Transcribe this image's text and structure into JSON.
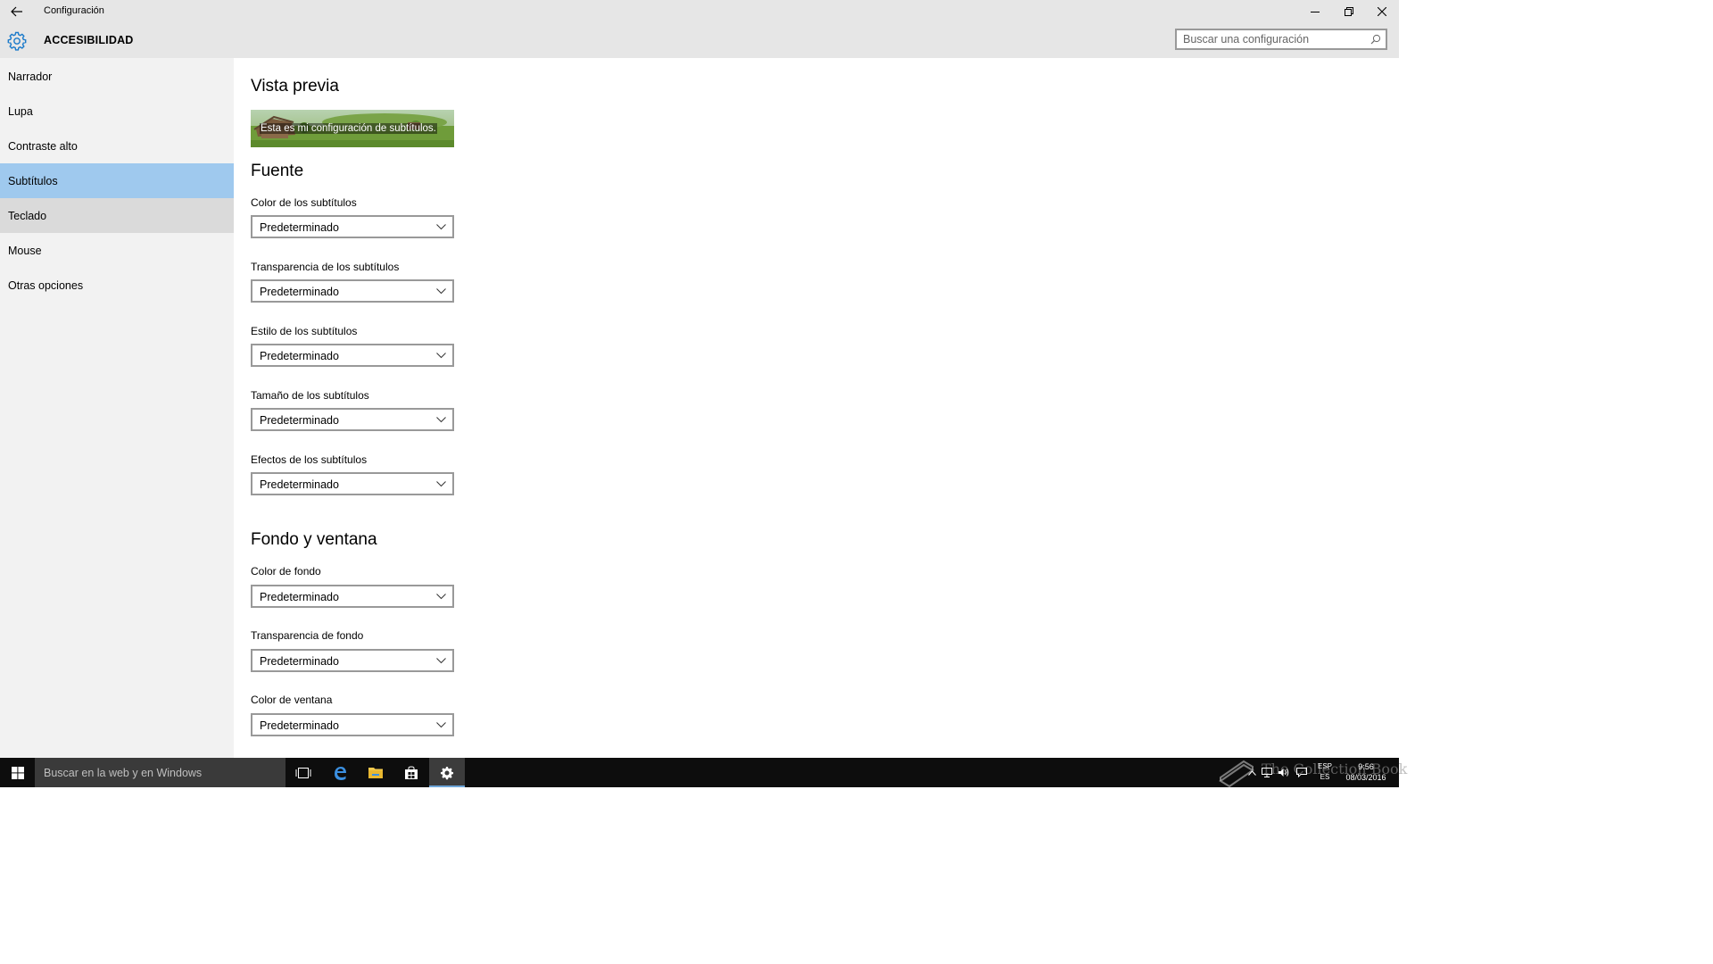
{
  "window": {
    "title": "Configuración"
  },
  "header": {
    "section_title": "ACCESIBILIDAD",
    "search_placeholder": "Buscar una configuración"
  },
  "sidebar": {
    "items": [
      {
        "label": "Narrador"
      },
      {
        "label": "Lupa"
      },
      {
        "label": "Contraste alto"
      },
      {
        "label": "Subtítulos",
        "selected": true
      },
      {
        "label": "Teclado"
      },
      {
        "label": "Mouse"
      },
      {
        "label": "Otras opciones"
      }
    ]
  },
  "main": {
    "preview_heading": "Vista previa",
    "preview_text": "Esta es mi configuración de subtítulos.",
    "font_heading": "Fuente",
    "font_settings": [
      {
        "label": "Color de los subtítulos",
        "value": "Predeterminado"
      },
      {
        "label": "Transparencia de los subtítulos",
        "value": "Predeterminado"
      },
      {
        "label": "Estilo de los subtítulos",
        "value": "Predeterminado"
      },
      {
        "label": "Tamaño de los subtítulos",
        "value": "Predeterminado"
      },
      {
        "label": "Efectos de los subtítulos",
        "value": "Predeterminado"
      }
    ],
    "background_heading": "Fondo y ventana",
    "background_settings": [
      {
        "label": "Color de fondo",
        "value": "Predeterminado"
      },
      {
        "label": "Transparencia de fondo",
        "value": "Predeterminado"
      },
      {
        "label": "Color de ventana",
        "value": "Predeterminado"
      }
    ]
  },
  "taskbar": {
    "search_placeholder": "Buscar en la web y en Windows",
    "watermark": "The Collection Book",
    "lang_top": "ESP",
    "lang_bottom": "ES",
    "time": "9:56",
    "date": "08/03/2016"
  },
  "colors": {
    "selected_nav": "#9fc9ee",
    "hover_nav": "#dadada",
    "accent": "#1979ca",
    "taskbar": "#0d0d0d"
  }
}
